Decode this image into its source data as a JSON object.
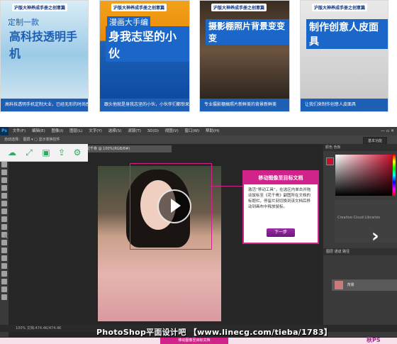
{
  "cards": [
    {
      "brand": "沪版大神养成手册之创意篇",
      "title_small": "定制一款",
      "title_big": "高科技透明手机",
      "caption": "高科技透明手机定制大业，已经无形的时尚感主角了。"
    },
    {
      "brand": "沪版大神养成手册之创意篇",
      "title_small": "漫画大手编",
      "title_big": "身我志坚的小伙",
      "caption": "跟头他就是身我志坚的小伙，小伙伴们都惊呆了！"
    },
    {
      "brand": "沪版大神养成手册之创意篇",
      "title_small": "",
      "title_big": "摄影棚照片背景变变变",
      "caption": "专业摄影棚搞照片新鲜美的背景新鲜美"
    },
    {
      "brand": "沪版大神养成手册之创意篇",
      "title_small": "",
      "title_big": "制作创意人皮面具",
      "caption": "让我们来制作创意人皮面具"
    }
  ],
  "photoshop": {
    "app_logo": "Ps",
    "menu": [
      "文件(F)",
      "编辑(E)",
      "图像(I)",
      "图层(L)",
      "文字(Y)",
      "选择(S)",
      "滤镜(T)",
      "3D(D)",
      "视图(V)",
      "窗口(W)",
      "帮助(H)"
    ],
    "window_controls": "— ▫ ✕",
    "options_text": "自动选择：  图层  ▾   □ 显示变换控件",
    "workspace": "基本功能",
    "doc_tab": "花千骨 @ 100%(RGB/8#)",
    "callout": {
      "title": "移动图像至目标文档",
      "body": "激活“移动工具”，在选区内单击并拖动鼠标至《花千骨》副图所在文档的标题栏，停留片刻切换到该文档后移动到画布中释放鼠标。",
      "next_button": "下一步"
    },
    "library_label": "Creative Cloud Libraries",
    "layers_title": "图层  通道  路径",
    "layer_name": "背景",
    "status": "100%   文档:474.4K/474.4K"
  },
  "watermark": "PhotoShop平面设计吧 【www.linecg.com/tieba/1783】",
  "bottom_chip": "移动图像至目标文档",
  "bottom_logo": "秋PS"
}
